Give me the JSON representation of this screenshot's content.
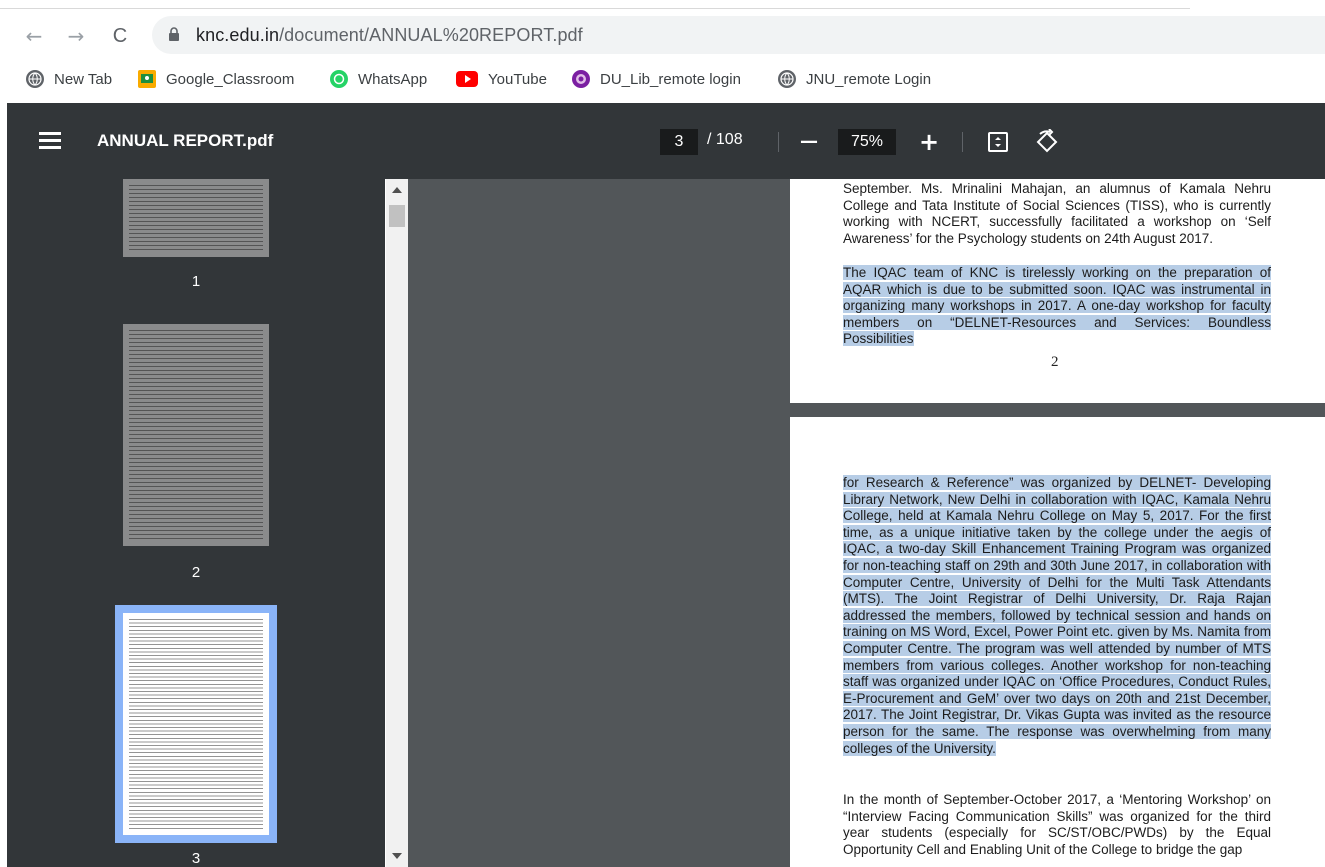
{
  "browser": {
    "url_domain": "knc.edu.in",
    "url_path": "/document/ANNUAL%20REPORT.pdf",
    "back_glyph": "←",
    "forward_glyph": "→",
    "reload_glyph": "C",
    "bookmarks": [
      {
        "label": "New Tab",
        "icon": "globe-icon",
        "color": "#5f6368"
      },
      {
        "label": "Google_Classroom",
        "icon": "classroom-icon",
        "color": "#f9ab00"
      },
      {
        "label": "WhatsApp",
        "icon": "whatsapp-icon",
        "color": "#25d366"
      },
      {
        "label": "YouTube",
        "icon": "youtube-icon",
        "color": "#ff0000"
      },
      {
        "label": "DU_Lib_remote login",
        "icon": "du-lib-icon",
        "color": "#7b1fa2"
      },
      {
        "label": "JNU_remote Login",
        "icon": "globe-icon",
        "color": "#5f6368"
      }
    ]
  },
  "pdf_toolbar": {
    "title": "ANNUAL REPORT.pdf",
    "current_page": "3",
    "total_pages": "/ 108",
    "zoom": "75%",
    "zoom_out_glyph": "—",
    "zoom_in_glyph": "+"
  },
  "sidebar": {
    "thumbnails": [
      {
        "label": "1"
      },
      {
        "label": "2"
      },
      {
        "label": "3",
        "selected": true
      }
    ]
  },
  "page2": {
    "paragraph1": "September. Ms. Mrinalini Mahajan, an alumnus of Kamala Nehru College and Tata Institute of Social Sciences (TISS), who is currently working with NCERT, successfully facilitated a workshop on ‘Self Awareness’ for the Psychology students on 24th August 2017.",
    "paragraph2": "The IQAC team of KNC is tirelessly working on the preparation of AQAR which is due to be submitted soon. IQAC was instrumental in organizing many workshops in 2017. A one-day workshop for faculty members on “DELNET-Resources and Services: Boundless Possibilities",
    "page_number": "2"
  },
  "page3": {
    "paragraph1": "for Research & Reference” was organized by DELNET- Developing Library Network, New Delhi in collaboration with IQAC, Kamala Nehru College, held at Kamala Nehru College on May 5, 2017. For the first time, as a unique initiative taken by the college under the aegis of IQAC, a two-day Skill Enhancement Training Program was organized for non-teaching staff on 29th and 30th June 2017, in collaboration with Computer Centre, University of Delhi for the Multi Task Attendants (MTS). The Joint Registrar of Delhi University, Dr. Raja Rajan addressed the members, followed by technical session and hands on training on MS Word, Excel, Power Point etc. given by Ms. Namita from Computer Centre. The program was well attended by number of MTS members from various colleges. Another workshop for non-teaching staff was organized under IQAC on ‘Office Procedures, Conduct Rules, E-Procurement and GeM’ over two days on 20th and 21st December, 2017. The Joint Registrar, Dr. Vikas Gupta was invited as the resource person for the same. The response was overwhelming from many colleges of the University.",
    "paragraph2": "In the month of September-October 2017, a ‘Mentoring Workshop’ on “Interview Facing Communication Skills” was organized for the third year students (especially for SC/ST/OBC/PWDs) by the Equal Opportunity Cell and Enabling Unit of the College to bridge the gap"
  },
  "colors": {
    "toolbar_bg": "#323639",
    "viewer_bg": "#525659",
    "selection_highlight": "#b7cde6",
    "thumbnail_selected_border": "#8ab4f8"
  }
}
